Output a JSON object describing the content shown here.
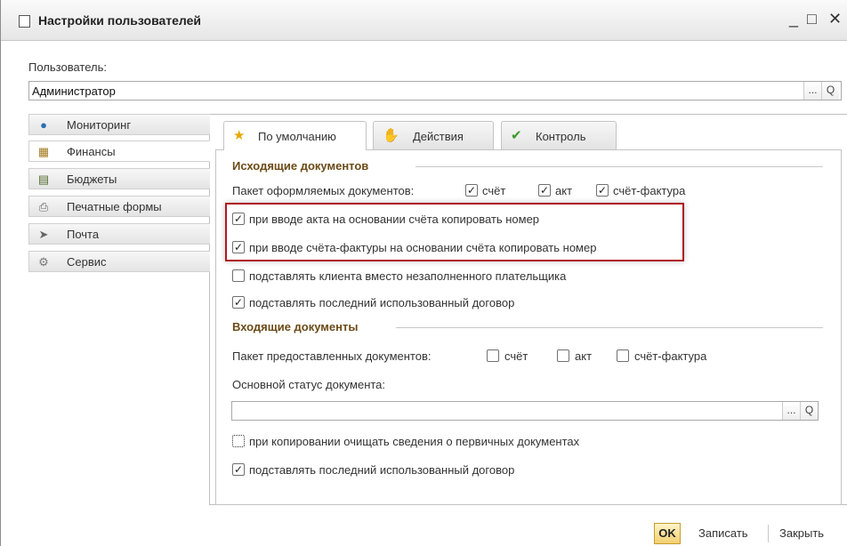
{
  "window": {
    "title": "Настройки пользователей",
    "minimize": "_",
    "maximize": "□",
    "close": "✕"
  },
  "user": {
    "label": "Пользователь:",
    "value": "Администратор",
    "select_btn": "...",
    "search_btn": "Q"
  },
  "sidebar": {
    "items": [
      {
        "label": "Мониторинг",
        "icon": "globe-icon"
      },
      {
        "label": "Финансы",
        "icon": "calculator-icon"
      },
      {
        "label": "Бюджеты",
        "icon": "spreadsheet-icon"
      },
      {
        "label": "Печатные формы",
        "icon": "printer-icon"
      },
      {
        "label": "Почта",
        "icon": "paper-plane-icon"
      },
      {
        "label": "Сервис",
        "icon": "gear-icon"
      }
    ],
    "active": "Финансы"
  },
  "tabs": [
    {
      "label": "По умолчанию",
      "icon": "star-icon"
    },
    {
      "label": "Действия",
      "icon": "hand-icon"
    },
    {
      "label": "Контроль",
      "icon": "checkmark-icon"
    }
  ],
  "outgoing": {
    "title": "Исходящие документов",
    "package_label": "Пакет оформляемых документов:",
    "package": [
      {
        "label": "счёт",
        "checked": true
      },
      {
        "label": "акт",
        "checked": true
      },
      {
        "label": "счёт-фактура",
        "checked": true
      }
    ],
    "options": [
      {
        "label": "при вводе акта на основании счёта копировать номер",
        "checked": true
      },
      {
        "label": "при вводе счёта-фактуры на основании счёта копировать номер",
        "checked": true
      },
      {
        "label": "подставлять клиента вместо незаполненного плательщика",
        "checked": false
      },
      {
        "label": "подставлять последний использованный договор",
        "checked": true
      }
    ]
  },
  "incoming": {
    "title": "Входящие документы",
    "package_label": "Пакет предоставленных документов:",
    "package": [
      {
        "label": "счёт",
        "checked": false
      },
      {
        "label": "акт",
        "checked": false
      },
      {
        "label": "счёт-фактура",
        "checked": false
      }
    ],
    "status_label": "Основной статус документа:",
    "status_value": "",
    "select_btn": "...",
    "search_btn": "Q",
    "options": [
      {
        "label": "при копировании очищать сведения о первичных документах",
        "checked": false
      },
      {
        "label": "подставлять последний использованный договор",
        "checked": true
      }
    ]
  },
  "footer": {
    "ok": "OK",
    "save": "Записать",
    "close": "Закрыть"
  },
  "colors": {
    "group_title": "#6b4b16",
    "highlight_border": "#b01820",
    "ok_button": "#f2d070"
  }
}
